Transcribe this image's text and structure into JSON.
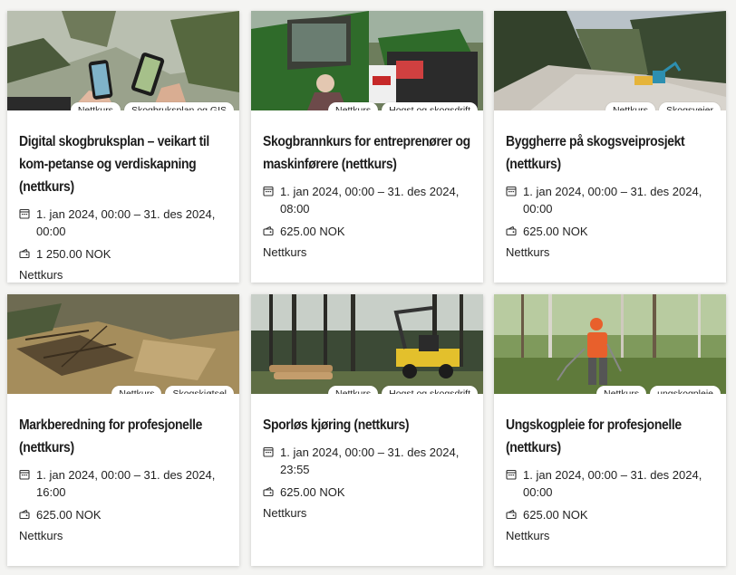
{
  "courses": [
    {
      "tags": [
        "Nettkurs",
        "Skogbruksplan og GIS"
      ],
      "title": "Digital skogbruksplan – veikart til kom-petanse og verdiskapning (nettkurs)",
      "date": "1. jan 2024, 00:00 – 31. des 2024, 00:00",
      "price": "1 250.00 NOK",
      "type": "Nettkurs"
    },
    {
      "tags": [
        "Nettkurs",
        "Hogst og skogsdrift"
      ],
      "title": "Skogbrannkurs for entreprenører og maskinførere (nettkurs)",
      "date": "1. jan 2024, 00:00 – 31. des 2024, 08:00",
      "price": "625.00 NOK",
      "type": "Nettkurs"
    },
    {
      "tags": [
        "Nettkurs",
        "Skogsveier"
      ],
      "title": "Byggherre på skogsveiprosjekt (nettkurs)",
      "date": "1. jan 2024, 00:00 – 31. des 2024, 00:00",
      "price": "625.00 NOK",
      "type": "Nettkurs"
    },
    {
      "tags": [
        "Nettkurs",
        "Skogskjøtsel"
      ],
      "title": "Markberedning for profesjonelle (nettkurs)",
      "date": "1. jan 2024, 00:00 – 31. des 2024, 16:00",
      "price": "625.00 NOK",
      "type": "Nettkurs"
    },
    {
      "tags": [
        "Nettkurs",
        "Hogst og skogsdrift"
      ],
      "title": "Sporløs kjøring (nettkurs)",
      "date": "1. jan 2024, 00:00 – 31. des 2024, 23:55",
      "price": "625.00 NOK",
      "type": "Nettkurs"
    },
    {
      "tags": [
        "Nettkurs",
        "ungskogpleie"
      ],
      "title": "Ungskogpleie for profesjonelle (nettkurs)",
      "date": "1. jan 2024, 00:00 – 31. des 2024, 00:00",
      "price": "625.00 NOK",
      "type": "Nettkurs"
    }
  ]
}
